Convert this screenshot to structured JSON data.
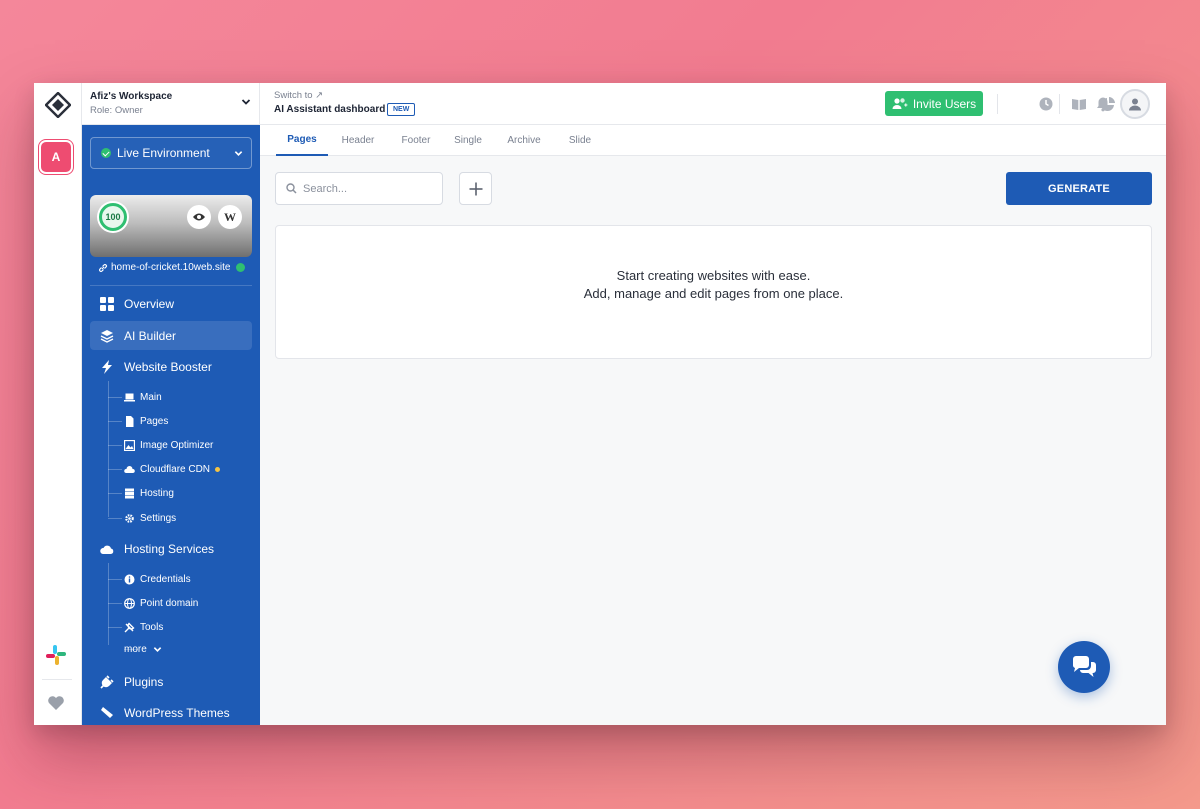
{
  "workspace": {
    "name": "Afiz's Workspace",
    "role": "Role: Owner",
    "avatar_letter": "A"
  },
  "sidebar": {
    "environment": "Live Environment",
    "score": "100",
    "domain": "home-of-cricket.10web.site",
    "wp_letter": "W",
    "nav": {
      "overview": "Overview",
      "ai_builder": "AI Builder",
      "website_booster": "Website Booster",
      "booster_items": [
        "Main",
        "Pages",
        "Image Optimizer",
        "Cloudflare CDN",
        "Hosting",
        "Settings"
      ],
      "hosting_services": "Hosting Services",
      "hosting_items": [
        "Credentials",
        "Point domain",
        "Tools"
      ],
      "more": "more",
      "plugins": "Plugins",
      "wordpress_themes": "WordPress Themes"
    }
  },
  "topbar": {
    "switch_to": "Switch to ↗",
    "dashboard": "AI Assistant dashboard",
    "new_badge": "NEW",
    "invite_label": "Invite Users"
  },
  "tabs": [
    "Pages",
    "Header",
    "Footer",
    "Single",
    "Archive",
    "Slide"
  ],
  "main": {
    "search_placeholder": "Search...",
    "generate_label": "GENERATE",
    "empty_line1": "Start creating websites with ease.",
    "empty_line2": "Add, manage and edit pages from one place."
  },
  "colors": {
    "primary": "#1e5bb5",
    "success": "#2fbf71",
    "accent": "#ee4c71"
  },
  "icons": [
    "logo-icon",
    "slack-icon",
    "heart-icon",
    "clock-icon",
    "book-icon",
    "pie-chart-icon",
    "bell-icon",
    "user-icon",
    "search-icon",
    "plus-icon",
    "chat-icon"
  ]
}
